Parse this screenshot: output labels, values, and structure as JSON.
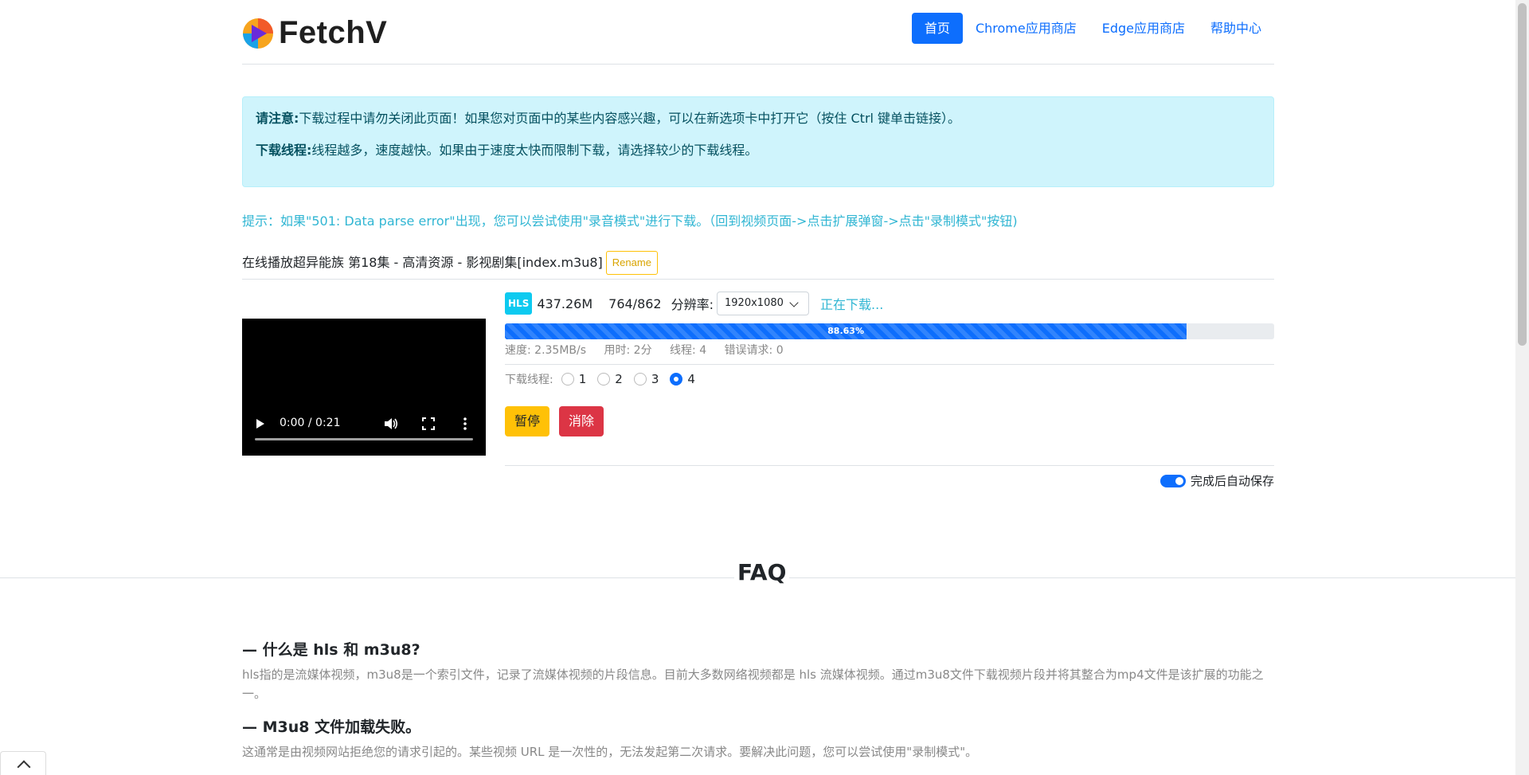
{
  "brand": {
    "name": "FetchV"
  },
  "nav": {
    "items": [
      {
        "label": "首页",
        "active": true
      },
      {
        "label": "Chrome应用商店"
      },
      {
        "label": "Edge应用商店"
      },
      {
        "label": "帮助中心"
      }
    ]
  },
  "alert": {
    "line1_label": "请注意:",
    "line1_text": "下载过程中请勿关闭此页面！如果您对页面中的某些内容感兴趣，可以在新选项卡中打开它（按住 Ctrl 键单击链接）。",
    "line2_label": "下载线程:",
    "line2_text": "线程越多，速度越快。如果由于速度太快而限制下载，请选择较少的下载线程。"
  },
  "tip": "提示：如果\"501: Data parse error\"出现，您可以尝试使用\"录音模式\"进行下载。（回到视频页面->点击扩展弹窗->点击\"录制模式\"按钮)",
  "file": {
    "title": "在线播放超异能族 第18集 - 高清资源 - 影视剧集[index.m3u8]",
    "rename_label": "Rename"
  },
  "video": {
    "time": "0:00 / 0:21"
  },
  "download": {
    "badge": "HLS",
    "size": "437.26M",
    "fragments": "764/862",
    "resolution_label": "分辨率:",
    "resolution_value": "1920x1080",
    "status": "正在下载...",
    "progress_percent": 88.63,
    "progress_label": "88.63%",
    "speed": "速度: 2.35MB/s",
    "elapsed": "用时: 2分",
    "threads_stat": "线程: 4",
    "errors": "错误请求: 0",
    "threads_label": "下载线程:",
    "thread_options": [
      "1",
      "2",
      "3",
      "4"
    ],
    "thread_selected": "4",
    "pause_label": "暂停",
    "cancel_label": "消除",
    "autosave_label": "完成后自动保存",
    "autosave_on": true
  },
  "faq": {
    "title": "FAQ",
    "items": [
      {
        "q": "— 什么是 hls 和 m3u8?",
        "a": "hls指的是流媒体视频，m3u8是一个索引文件，记录了流媒体视频的片段信息。目前大多数网络视频都是 hls 流媒体视频。通过m3u8文件下载视频片段并将其整合为mp4文件是该扩展的功能之一。"
      },
      {
        "q": "—  M3u8 文件加载失败。",
        "a": "这通常是由视频网站拒绝您的请求引起的。某些视频 URL 是一次性的，无法发起第二次请求。要解决此问题，您可以尝试使用\"录制模式\"。"
      }
    ]
  },
  "colors": {
    "primary": "#0d6efd",
    "info": "#0dcaf0",
    "warning": "#ffc107",
    "danger": "#dc3545"
  }
}
